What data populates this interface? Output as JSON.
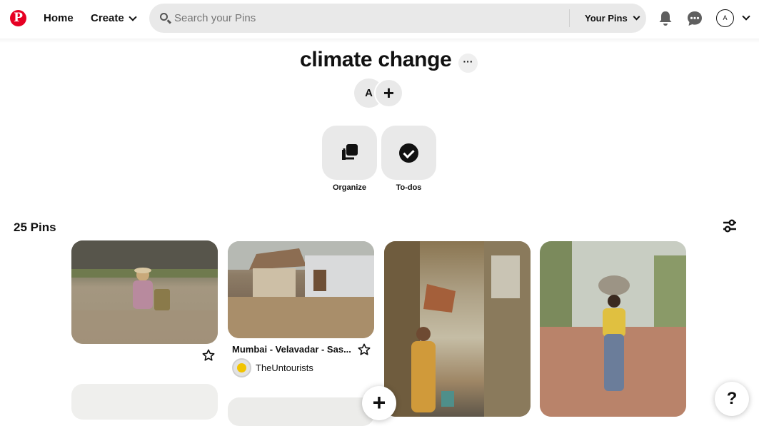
{
  "header": {
    "logo_letter": "P",
    "nav": {
      "home": "Home",
      "create": "Create"
    },
    "search": {
      "placeholder": "Search your Pins",
      "value": "",
      "scope": "Your Pins"
    },
    "account_initial": "A",
    "icons": [
      "search-icon",
      "bell-icon",
      "chat-icon",
      "chevron-down-icon"
    ]
  },
  "board": {
    "title": "climate change",
    "more": "···",
    "collaborator_initial": "A",
    "add_collaborator": "+",
    "tools": [
      {
        "label": "Organize",
        "icon": "organize-icon"
      },
      {
        "label": "To-dos",
        "icon": "checkmark-icon"
      }
    ],
    "pin_count": "25 Pins"
  },
  "pins": [
    {
      "name": "pin-flood-woman-basket",
      "saved_icon": "star-icon"
    },
    {
      "name": "pin-mumbai-velavadar",
      "title": "Mumbai - Velavadar - Sas...",
      "creator": "TheUntourists",
      "saved_icon": "star-icon"
    },
    {
      "name": "pin-alley-painting"
    },
    {
      "name": "pin-woman-carrying-water"
    },
    {
      "name": "pin-bottom-left"
    },
    {
      "name": "pin-bottom-second"
    }
  ],
  "fab": {
    "add": "+",
    "help": "?"
  },
  "colors": {
    "brand": "#e60023",
    "surface": "#e9e9e9",
    "text": "#111111"
  }
}
